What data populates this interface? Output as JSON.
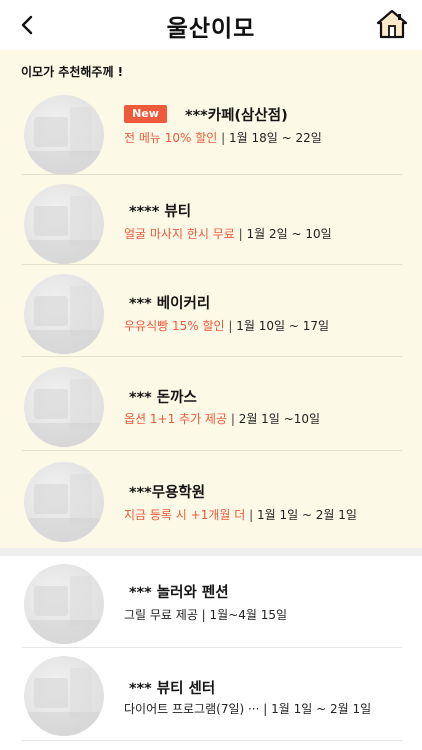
{
  "header": {
    "title": "울산이모",
    "back_icon": "chevron-left-icon",
    "home_icon": "home-icon"
  },
  "recommend": {
    "heading": "이모가 추천해주께 !",
    "badge_new": "New",
    "items": [
      {
        "name": "***카페(삼산점)",
        "promo": "전 메뉴 10% 할인",
        "sep": " | ",
        "period": "1월 18일 ~ 22일",
        "is_new": true
      },
      {
        "name": "**** 뷰티",
        "promo": "얼굴 마사지 한시 무료",
        "sep": " | ",
        "period": "1월 2일 ~ 10일",
        "is_new": false
      },
      {
        "name": "*** 베이커리",
        "promo": "우유식빵 15% 할인",
        "sep": " | ",
        "period": "1월 10일 ~ 17일",
        "is_new": false
      },
      {
        "name": "*** 돈까스",
        "promo": "옵션 1+1 추가 제공",
        "sep": " | ",
        "period": "2월 1일 ~10일",
        "is_new": false
      },
      {
        "name": "***무용학원",
        "promo": "지금 등록 시 +1개월 더",
        "sep": " | ",
        "period": "1월 1일 ~ 2월 1일",
        "is_new": false
      }
    ]
  },
  "others": {
    "items": [
      {
        "name": "*** 놀러와 펜션",
        "desc": "그릴 무료 제공 | 1월~4월 15일"
      },
      {
        "name": "*** 뷰티 센터",
        "desc": "다이어트 프로그램(7일) ··· | 1월 1일 ~ 2월 1일"
      }
    ]
  },
  "colors": {
    "accent": "#ef5a3c",
    "section_bg": "#fdf9e7"
  }
}
